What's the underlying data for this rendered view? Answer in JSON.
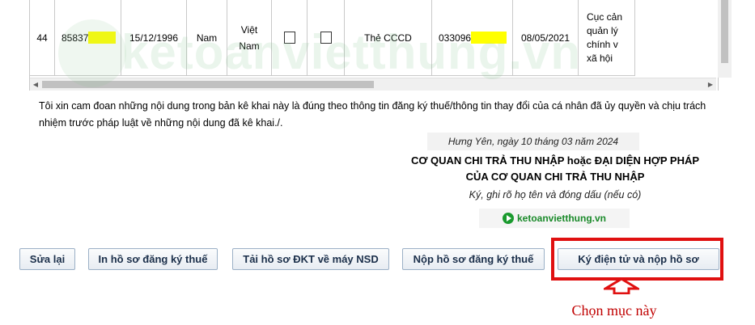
{
  "table": {
    "row": {
      "stt": "44",
      "tax_code": "85837",
      "birth_date": "15/12/1996",
      "gender": "Nam",
      "nationality": "Việt Nam",
      "doc_type": "Thẻ CCCD",
      "doc_number": "033096",
      "issue_date": "08/05/2021",
      "issued_by": "Cục cản\nquản lý\nchính v\nxã hội"
    }
  },
  "watermark": {
    "text": "ketoanvietthung.vn"
  },
  "declaration": {
    "text": "Tôi xin cam đoan những nội dung trong bản kê khai này là đúng theo thông tin đăng ký thuế/thông tin thay đổi của cá nhân đã ủy quyền và chịu trách nhiệm trước pháp luật về những nội dung đã kê khai./."
  },
  "signature": {
    "place_date": "Hưng Yên, ngày 10 tháng 03 năm 2024",
    "title_line1": "CƠ QUAN CHI TRẢ THU NHẬP hoặc ĐẠI DIỆN HỢP PHÁP",
    "title_line2": "CỦA CƠ QUAN CHI TRẢ THU NHẬP",
    "note": "Ký, ghi rõ họ tên và đóng dấu (nếu có)",
    "brand": "ketoanvietthung.vn"
  },
  "buttons": {
    "edit": "Sửa lại",
    "print": "In hồ sơ đăng ký thuế",
    "download": "Tải hồ sơ ĐKT về máy NSD",
    "submit": "Nộp hồ sơ đăng ký thuế",
    "sign_submit": "Ký điện tử và nộp hồ sơ"
  },
  "annotation": {
    "text": "Chọn mục này",
    "color": "#c00000"
  }
}
